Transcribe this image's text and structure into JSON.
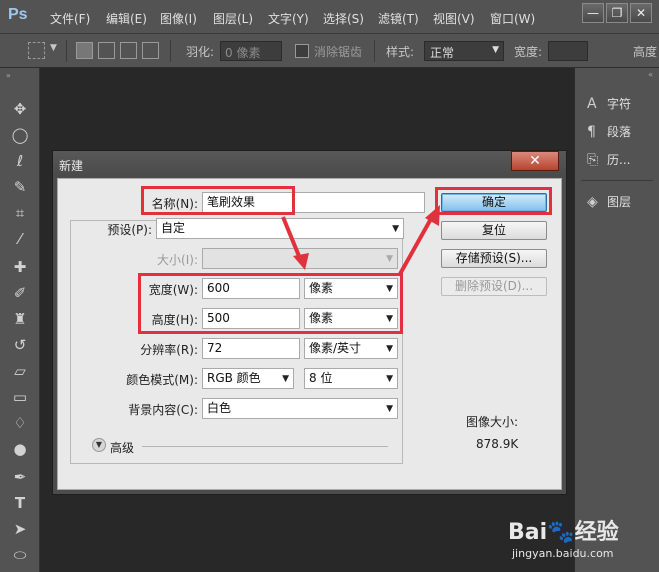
{
  "app": {
    "logo": "Ps"
  },
  "menu": [
    "文件(F)",
    "编辑(E)",
    "图像(I)",
    "图层(L)",
    "文字(Y)",
    "选择(S)",
    "滤镜(T)",
    "视图(V)",
    "窗口(W)"
  ],
  "window_controls": {
    "minimize": "—",
    "restore": "❐",
    "close": "✕"
  },
  "options_bar": {
    "feather_label": "羽化:",
    "feather_value": "0 像素",
    "antialias_label": "消除锯齿",
    "style_label": "样式:",
    "style_value": "正常",
    "width_label": "宽度:",
    "height_label": "高度"
  },
  "tools": [
    "move-tool-icon",
    "ellipse-marquee-icon",
    "lasso-icon",
    "quick-select-icon",
    "crop-icon",
    "eyedropper-icon",
    "healing-brush-icon",
    "brush-icon",
    "stamp-icon",
    "history-brush-icon",
    "eraser-icon",
    "gradient-icon",
    "blur-icon",
    "dodge-icon",
    "pen-icon",
    "type-icon",
    "path-select-icon",
    "shape-icon"
  ],
  "panels": [
    {
      "icon": "character-icon",
      "label": "字符"
    },
    {
      "icon": "paragraph-icon",
      "label": "段落"
    },
    {
      "icon": "history-icon",
      "label": "历..."
    },
    {
      "icon": "layers-icon",
      "label": "图层"
    }
  ],
  "dialog": {
    "title": "新建",
    "name_label": "名称(N):",
    "name_value": "笔刷效果",
    "preset_label": "预设(P):",
    "preset_value": "自定",
    "size_label": "大小(I):",
    "width_label": "宽度(W):",
    "width_value": "600",
    "width_unit": "像素",
    "height_label": "高度(H):",
    "height_value": "500",
    "height_unit": "像素",
    "resolution_label": "分辨率(R):",
    "resolution_value": "72",
    "resolution_unit": "像素/英寸",
    "color_mode_label": "颜色模式(M):",
    "color_mode_value": "RGB 颜色",
    "bit_depth_value": "8 位",
    "background_label": "背景内容(C):",
    "background_value": "白色",
    "advanced_label": "高级",
    "buttons": {
      "ok": "确定",
      "reset": "复位",
      "save_preset": "存储预设(S)...",
      "delete_preset": "删除预设(D)..."
    },
    "image_size_label": "图像大小:",
    "image_size_value": "878.9K"
  },
  "watermark": {
    "brand": "Bai",
    "brand_cn": "经验",
    "url": "jingyan.baidu.com"
  },
  "colors": {
    "highlight": "#e0313c",
    "accent": "#6fb6e6"
  }
}
